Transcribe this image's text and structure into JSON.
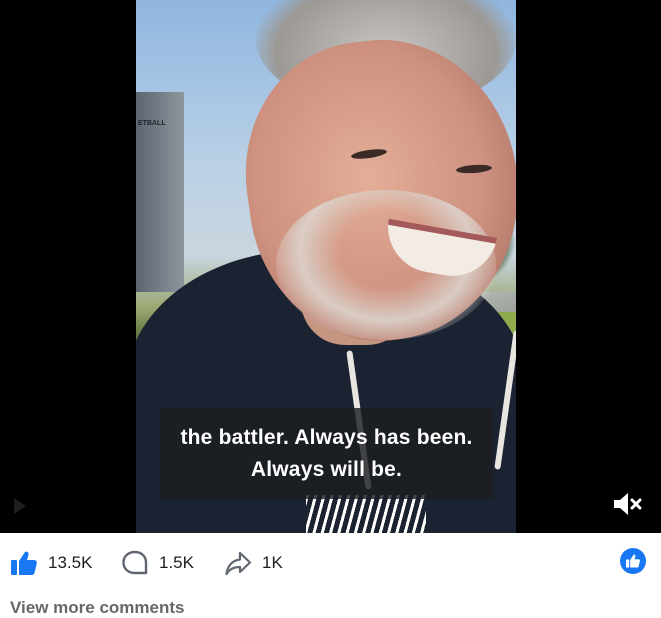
{
  "video": {
    "caption_line1": "the battler. Always has been.",
    "caption_line2": "Always will be.",
    "sign_text": "ETBALL",
    "mute_icon": "speaker-muted-icon"
  },
  "reactions": {
    "likes": "13.5K",
    "comments": "1.5K",
    "shares": "1K",
    "like_icon": "thumbs-up-icon",
    "comment_icon": "comment-bubble-icon",
    "share_icon": "share-arrow-icon",
    "reaction_badge_icon": "like-reaction-badge-icon",
    "accent_color": "#1877f2"
  },
  "footer": {
    "view_more": "View more comments"
  }
}
